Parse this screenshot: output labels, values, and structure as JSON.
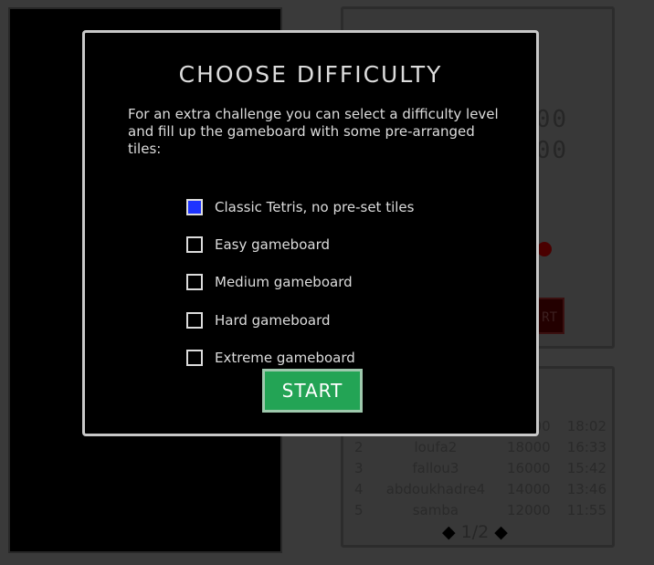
{
  "background": {
    "stats": [
      "00",
      "00"
    ],
    "start_label": "RT",
    "highscores": {
      "visible_row": {
        "score": "00",
        "time": "18:02"
      },
      "rows": [
        {
          "rank": "2",
          "name": "loufa2",
          "score": "18000",
          "time": "16:33"
        },
        {
          "rank": "3",
          "name": "fallou3",
          "score": "16000",
          "time": "15:42"
        },
        {
          "rank": "4",
          "name": "abdoukhadre4",
          "score": "14000",
          "time": "13:46"
        },
        {
          "rank": "5",
          "name": "samba",
          "score": "12000",
          "time": "11:55"
        }
      ],
      "pager": {
        "prev_icon": "diamond-left-icon",
        "page": "1/2",
        "next_icon": "diamond-right-icon"
      }
    }
  },
  "modal": {
    "title": "CHOOSE DIFFICULTY",
    "description": "For an extra challenge you can select a difficulty level and fill up the gameboard with some pre-arranged tiles:",
    "options": [
      {
        "label": "Classic Tetris, no pre-set tiles",
        "checked": true
      },
      {
        "label": "Easy gameboard",
        "checked": false
      },
      {
        "label": "Medium gameboard",
        "checked": false
      },
      {
        "label": "Hard gameboard",
        "checked": false
      },
      {
        "label": "Extreme gameboard",
        "checked": false
      }
    ],
    "start_label": "START"
  },
  "colors": {
    "checked": "#1d33ff",
    "start_button": "#23a455",
    "modal_border": "#c8c8c8"
  }
}
